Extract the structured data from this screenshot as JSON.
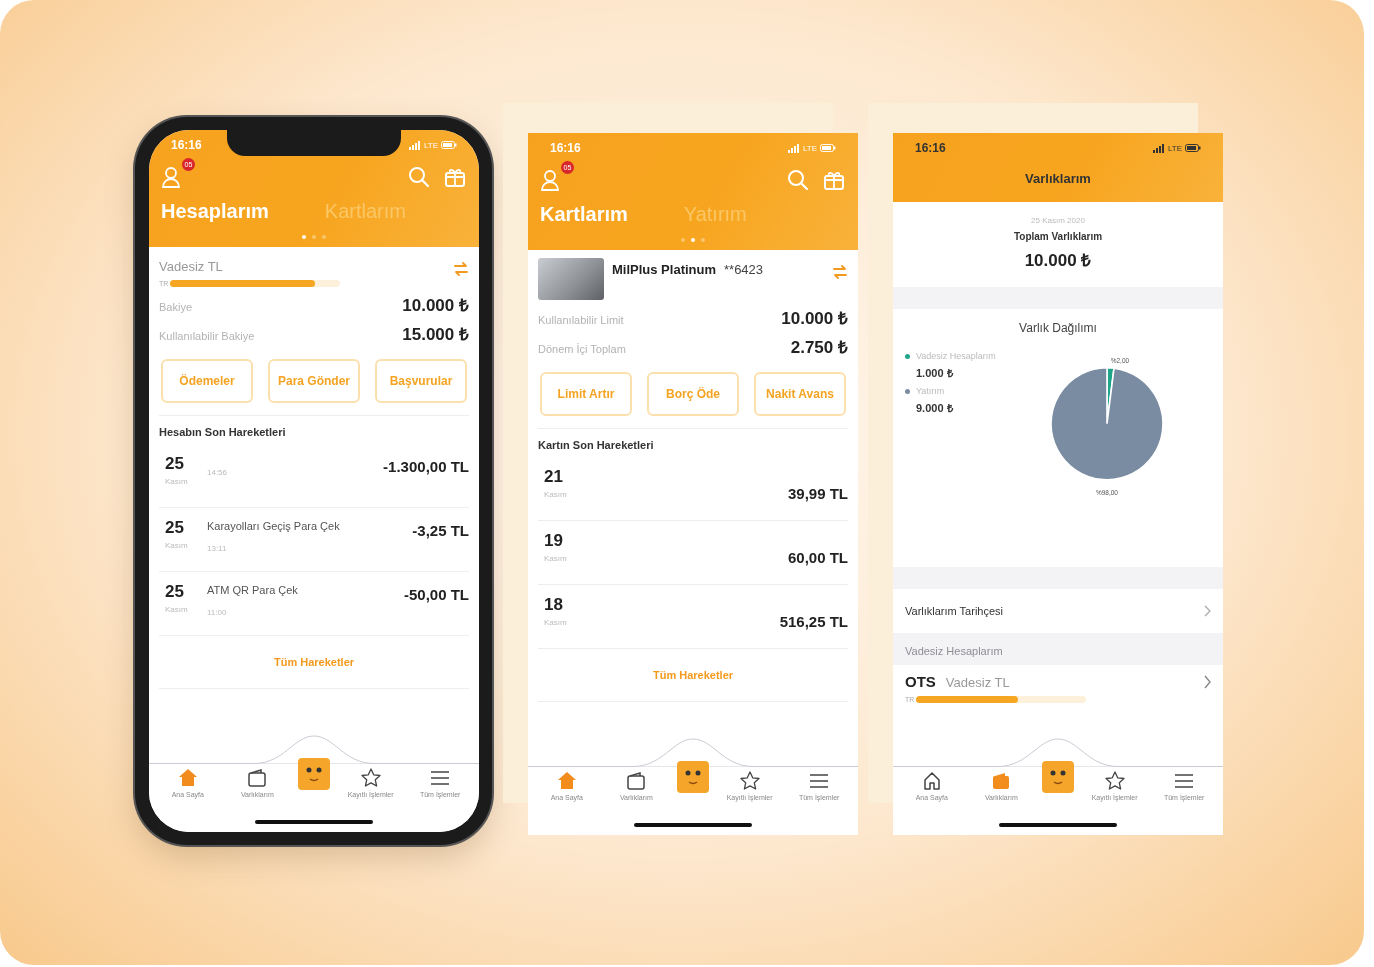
{
  "screens": [
    {
      "kind": "overview",
      "status": {
        "time": "16:16",
        "network": "LTE"
      },
      "badge": "05",
      "tabs": [
        {
          "label": "Hesaplarım",
          "selected": true
        },
        {
          "label": "Kartlarım",
          "selected": false
        }
      ],
      "dots": [
        {
          "selected": true
        },
        {
          "selected": false
        },
        {
          "selected": false
        }
      ],
      "product": {
        "kind": "account",
        "title": "Vadesiz TL",
        "prefix": "TR",
        "level": 0.85
      },
      "rows": [
        {
          "label": "Bakiye",
          "value": "10.000 ₺"
        },
        {
          "label": "Kullanılabilir Bakiye",
          "value": "15.000 ₺"
        }
      ],
      "actions": [
        "Ödemeler",
        "Para Gönder",
        "Başvurular"
      ],
      "section_title": "Hesabın Son Hareketleri",
      "transactions": [
        {
          "day": "25",
          "month": "Kasım",
          "time": "14:56",
          "amount": "-1.300,00 TL"
        },
        {
          "day": "25",
          "month": "Kasım",
          "time": "13:11",
          "description": "Karayolları Geçiş Para Çek",
          "amount": "-3,25 TL"
        },
        {
          "day": "25",
          "month": "Kasım",
          "time": "11:00",
          "description": "ATM QR Para Çek",
          "amount": "-50,00 TL"
        }
      ],
      "all_link": "Tüm Hareketler",
      "nav": [
        {
          "kind": "home",
          "label": "Ana Sayfa",
          "selected": true
        },
        {
          "kind": "wallet",
          "label": "Varlıklarım",
          "selected": false
        },
        {
          "kind": "mascot"
        },
        {
          "kind": "star",
          "label": "Kayıtlı İşlemler",
          "selected": false
        },
        {
          "kind": "menu",
          "label": "Tüm İşlemler",
          "selected": false
        }
      ]
    },
    {
      "kind": "overview",
      "status": {
        "time": "16:16",
        "network": "LTE"
      },
      "badge": "05",
      "tabs": [
        {
          "label": "Kartlarım",
          "selected": true
        },
        {
          "label": "Yatırım",
          "selected": false
        }
      ],
      "dots": [
        {
          "selected": false
        },
        {
          "selected": true
        },
        {
          "selected": false
        }
      ],
      "product": {
        "kind": "card",
        "title": "MilPlus Platinum",
        "number": "**6423"
      },
      "rows": [
        {
          "label": "Kullanılabilir Limit",
          "value": "10.000 ₺"
        },
        {
          "label": "Dönem İçi Toplam",
          "value": "2.750 ₺"
        }
      ],
      "actions": [
        "Limit Artır",
        "Borç Öde",
        "Nakit Avans"
      ],
      "section_title": "Kartın Son Hareketleri",
      "transactions": [
        {
          "day": "21",
          "month": "Kasım",
          "amount": "39,99 TL"
        },
        {
          "day": "19",
          "month": "Kasım",
          "amount": "60,00 TL"
        },
        {
          "day": "18",
          "month": "Kasım",
          "amount": "516,25 TL"
        }
      ],
      "all_link": "Tüm Hareketler",
      "nav": [
        {
          "kind": "home",
          "label": "Ana Sayfa",
          "selected": true
        },
        {
          "kind": "wallet",
          "label": "Varlıklarım",
          "selected": false
        },
        {
          "kind": "mascot"
        },
        {
          "kind": "star",
          "label": "Kayıtlı İşlemler",
          "selected": false
        },
        {
          "kind": "menu",
          "label": "Tüm İşlemler",
          "selected": false
        }
      ]
    },
    {
      "kind": "assets",
      "status": {
        "time": "16:16",
        "network": "LTE"
      },
      "title": "Varlıklarım",
      "date": "25 Kasım 2020",
      "total_label": "Toplam Varlıklarım",
      "total": "10.000 ₺",
      "chart_title": "Varlık Dağılımı",
      "legend": [
        {
          "value": "1.000 ₺",
          "color": "#1fa58a"
        },
        {
          "value": "9.000 ₺",
          "color": "#7a8ca2"
        }
      ],
      "chart_data": {
        "type": "pie",
        "categories": [
          "Vadesiz Hesaplarım",
          "Yatırım"
        ],
        "values": [
          2,
          98
        ],
        "value_labels": [
          "%2,00",
          "%98,00"
        ]
      },
      "history_link": "Varlıklarım Tarihçesi",
      "group_title": "Vadesiz Hesaplarım",
      "account": {
        "code": "OTS",
        "name": "Vadesiz TL",
        "prefix": "TR",
        "level": 0.6
      },
      "nav": [
        {
          "kind": "home",
          "label": "Ana Sayfa",
          "selected": false
        },
        {
          "kind": "wallet",
          "label": "Varlıklarım",
          "selected": true
        },
        {
          "kind": "mascot"
        },
        {
          "kind": "star",
          "label": "Kayıtlı İşlemler",
          "selected": false
        },
        {
          "kind": "menu",
          "label": "Tüm İşlemler",
          "selected": false
        }
      ]
    }
  ]
}
